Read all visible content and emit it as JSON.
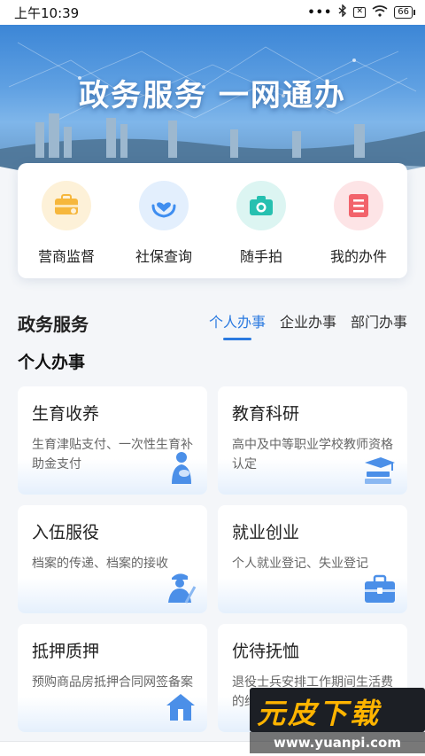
{
  "status_bar": {
    "time": "上午10:39",
    "battery": "66"
  },
  "banner": {
    "title": "政务服务 一网通办"
  },
  "quick_actions": [
    {
      "label": "营商监督",
      "icon": "briefcase-icon",
      "color": "#f6b73c"
    },
    {
      "label": "社保查询",
      "icon": "heart-hand-icon",
      "color": "#3f8ef0"
    },
    {
      "label": "随手拍",
      "icon": "camera-icon",
      "color": "#26c0b0"
    },
    {
      "label": "我的办件",
      "icon": "list-icon",
      "color": "#f2636b"
    }
  ],
  "section": {
    "title": "政务服务",
    "tabs": [
      "个人办事",
      "企业办事",
      "部门办事"
    ],
    "active_tab": "个人办事"
  },
  "sub_title": "个人办事",
  "services": [
    {
      "name": "生育收养",
      "desc": "生育津贴支付、一次性生育补助金支付",
      "icon": "mother-icon"
    },
    {
      "name": "教育科研",
      "desc": "高中及中等职业学校教师资格认定",
      "icon": "graduation-cap-icon"
    },
    {
      "name": "入伍服役",
      "desc": "档案的传递、档案的接收",
      "icon": "soldier-icon"
    },
    {
      "name": "就业创业",
      "desc": "个人就业登记、失业登记",
      "icon": "suitcase-icon"
    },
    {
      "name": "抵押质押",
      "desc": "预购商品房抵押合同网签备案",
      "icon": "house-icon"
    },
    {
      "name": "优待抚恤",
      "desc": "退役士兵安排工作期间生活费的给付",
      "icon": "medal-icon"
    }
  ],
  "watermark": {
    "brand": "元皮下载",
    "url": "www.yuanpi.com"
  }
}
